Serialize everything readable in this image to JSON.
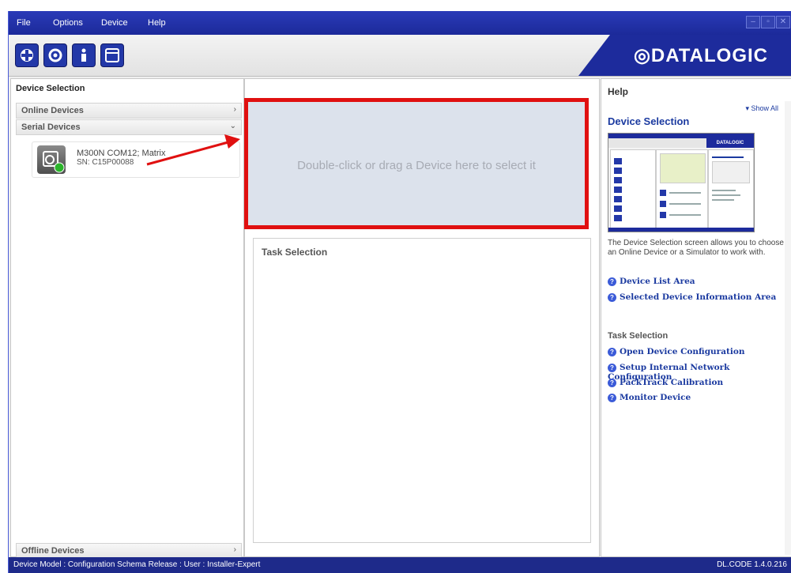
{
  "menu": [
    "File",
    "Options",
    "Device",
    "Help"
  ],
  "brand": {
    "logo": "DATALOGIC",
    "logo_color": "#1d2b9c"
  },
  "toolbar": {
    "buttons": [
      {
        "name": "getting-started-icon"
      },
      {
        "name": "device-config-icon"
      },
      {
        "name": "info-icon"
      },
      {
        "name": "window-icon"
      }
    ]
  },
  "left": {
    "title": "Device Selection",
    "online": "Online Devices",
    "serial": "Serial Devices",
    "offline": "Offline Devices",
    "device": {
      "name": "M300N COM12; Matrix",
      "sn": "SN: C15P00088"
    }
  },
  "center": {
    "drop_text": "Double-click or drag a Device here to select it",
    "task_title": "Task Selection",
    "highlight_color": "#e01010"
  },
  "help": {
    "title": "Help",
    "show_all": "▾ Show All",
    "heading": "Device Selection",
    "paragraph": "The Device Selection screen allows you to choose an Online Device or a Simulator to work with.",
    "links_a": [
      "Device List Area",
      "Selected Device Information Area"
    ],
    "task_header": "Task Selection",
    "links_b": [
      "Open Device Configuration",
      "Setup Internal Network Configuration",
      "PackTrack Calibration",
      "Monitor Device"
    ]
  },
  "status": {
    "left": "Device Model :   Configuration Schema Release :    User : Installer-Expert",
    "right": "DL.CODE 1.4.0.216"
  }
}
